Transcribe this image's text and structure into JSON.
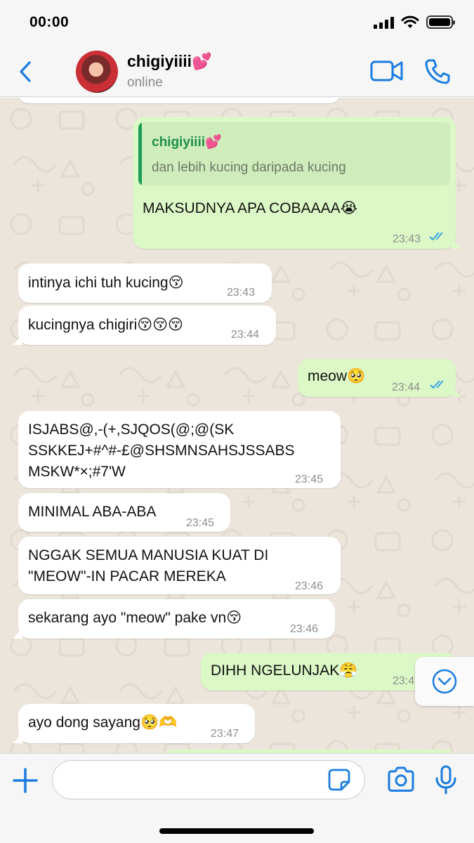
{
  "status_bar": {
    "time": "00:00"
  },
  "header": {
    "contact_name": "chigiyiiii💕",
    "contact_status": "online",
    "colors": {
      "accent": "#1a7ce0"
    }
  },
  "messages": [
    {
      "direction": "outgoing",
      "reply_to": {
        "author": "chigiyiiii💕",
        "text": "dan lebih kucing daripada kucing"
      },
      "text": "MAKSUDNYA APA COBAAAA😭",
      "time": "23:43",
      "status": "read"
    },
    {
      "direction": "incoming",
      "text": "intinya ichi tuh kucing😚",
      "time": "23:43"
    },
    {
      "direction": "incoming",
      "text": "kucingnya chigiri😚😚😚",
      "time": "23:44"
    },
    {
      "direction": "outgoing",
      "text": "meow🥺",
      "time": "23:44",
      "status": "read"
    },
    {
      "direction": "incoming",
      "lines": [
        "ISJABS@,-(+,SJQOS(@;@(SK",
        "SSKKEJ+#^#-£@SHSMNSAHSJSSABS",
        "MSKW*×;#7'W"
      ],
      "time": "23:45"
    },
    {
      "direction": "incoming",
      "text": "MINIMAL ABA-ABA",
      "time": "23:45"
    },
    {
      "direction": "incoming",
      "lines": [
        "NGGAK SEMUA MANUSIA KUAT DI",
        "\"MEOW\"-IN PACAR MEREKA"
      ],
      "time": "23:46"
    },
    {
      "direction": "incoming",
      "text": "sekarang ayo \"meow\" pake vn😚",
      "time": "23:46"
    },
    {
      "direction": "outgoing",
      "text": "DIHH NGELUNJAK😤",
      "time": "23:4"
    },
    {
      "direction": "incoming",
      "text": "ayo dong sayang🥺🫶",
      "time": "23:47"
    }
  ],
  "input": {
    "placeholder": ""
  },
  "icons": [
    "back-chevron-icon",
    "video-call-icon",
    "phone-icon",
    "plus-icon",
    "sticker-icon",
    "camera-icon",
    "microphone-icon",
    "chevron-down-icon"
  ]
}
